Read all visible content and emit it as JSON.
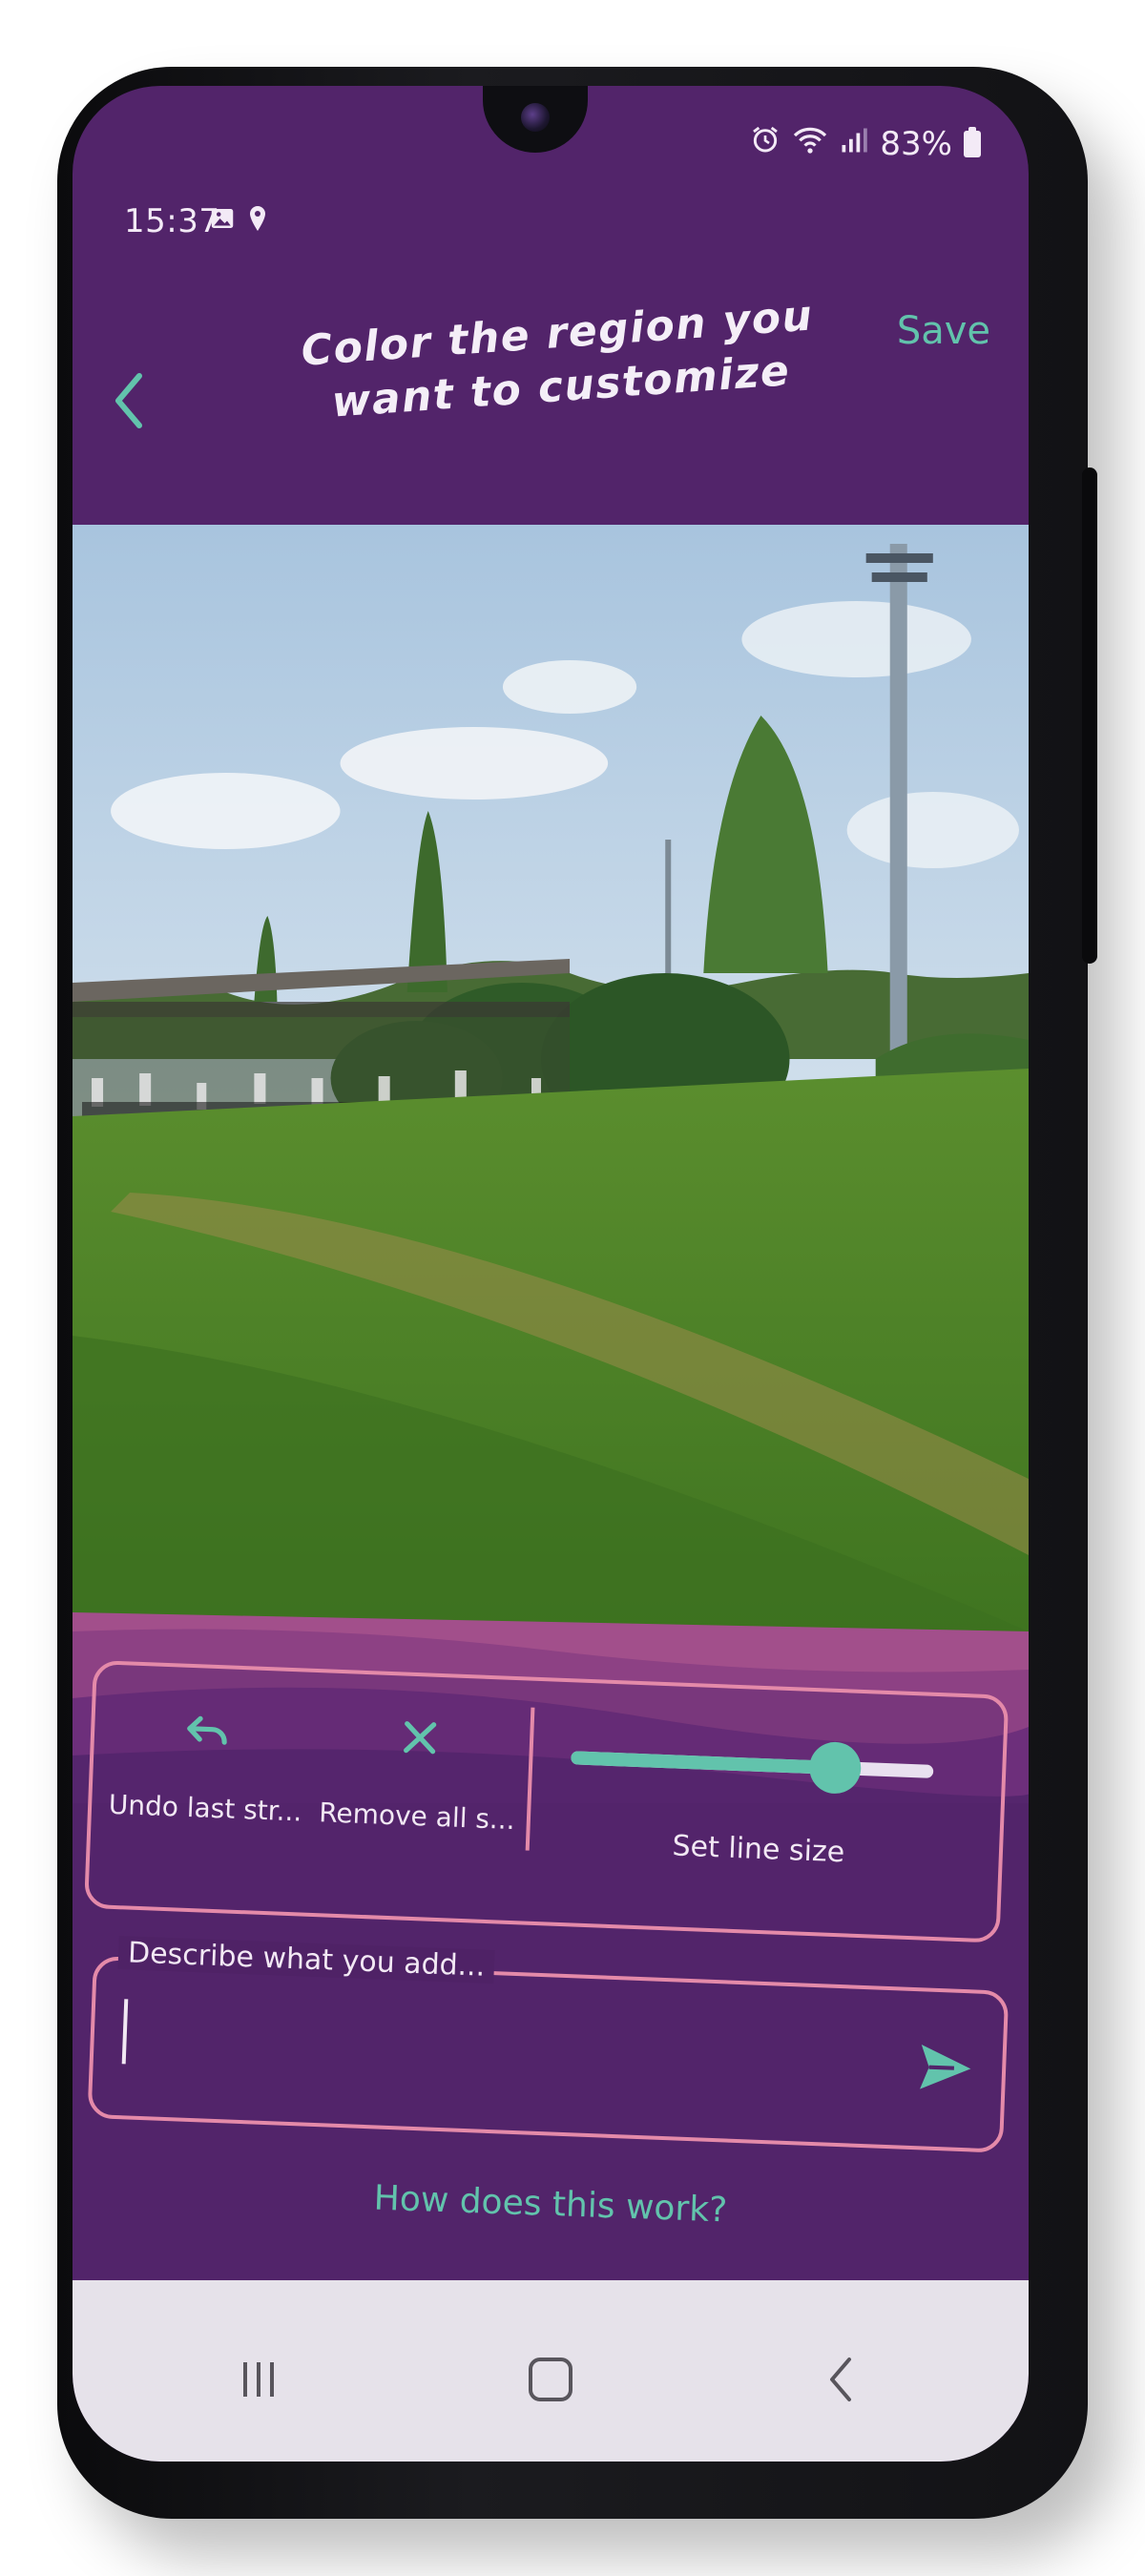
{
  "status_bar": {
    "time": "15:37",
    "battery": "83%",
    "left_icons": [
      "image-icon",
      "location-pin-icon"
    ],
    "right_icons": [
      "alarm-icon",
      "wifi-icon",
      "signal-icon",
      "battery-icon"
    ]
  },
  "app_bar": {
    "title": "Color the region you want to customize",
    "save_label": "Save",
    "back_icon": "chevron-left-icon"
  },
  "tools": {
    "undo": {
      "label": "Undo last str...",
      "icon": "undo-icon"
    },
    "clear": {
      "label": "Remove all s...",
      "icon": "close-icon"
    },
    "line_size": {
      "label": "Set line size",
      "value": 0.73
    }
  },
  "describe_field": {
    "label": "Describe what you add...",
    "value": "",
    "send_icon": "send-icon"
  },
  "help_link": "How does this work?",
  "nav_bar": {
    "items": [
      "recent-apps-icon",
      "home-icon",
      "back-icon"
    ]
  },
  "colors": {
    "primary": "#52246a",
    "accent": "#62c3ac",
    "outline": "#e48aa9",
    "text": "#f2e8f4"
  }
}
